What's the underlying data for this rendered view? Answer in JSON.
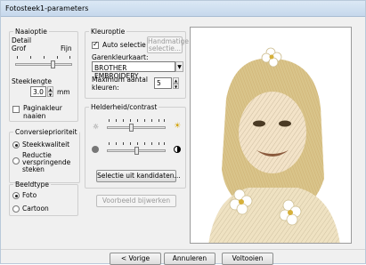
{
  "window": {
    "title": "Fotosteek1-parameters"
  },
  "naaioptie": {
    "legend": "Naaioptie",
    "detail_label": "Detail",
    "grof": "Grof",
    "fijn": "Fijn",
    "detail_level": 0.67,
    "steeklengte_label": "Steeklengte",
    "steeklengte_value": "3.0",
    "unit": "mm",
    "paginakleur": "Paginakleur naaien"
  },
  "conversie": {
    "legend": "Conversieprioriteit",
    "options": [
      "Steekkwaliteit",
      "Reductie verspringende steken"
    ],
    "selected": 0
  },
  "beeldtype": {
    "legend": "Beeldtype",
    "options": [
      "Foto",
      "Cartoon"
    ],
    "selected": 0
  },
  "kleuroptie": {
    "legend": "Kleuroptie",
    "auto_selectie": "Auto selectie",
    "handmatige_selectie": "Handmatige selectie...",
    "garenkleur_label": "Garenkleurkaart:",
    "garenkleur_value": "BROTHER EMBROIDERY",
    "max_label_line1": "Maximum aantal",
    "max_label_line2": "kleuren:",
    "max_value": "5"
  },
  "helderheid": {
    "legend": "Helderheid/contrast",
    "brightness_level": 0.43,
    "contrast_level": 0.52,
    "selectie_button": "Selectie uit kandidaten...",
    "voorbeeld_button": "Voorbeeld bijwerken"
  },
  "footer": {
    "vorige": "< Vorige",
    "annuleren": "Annuleren",
    "voltooien": "Voltooien"
  },
  "preview": {
    "description_icon": "embroidery-photo-preview-icon"
  }
}
